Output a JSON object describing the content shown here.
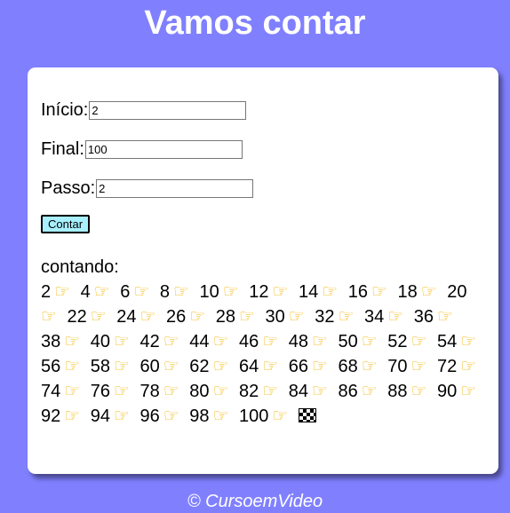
{
  "header": {
    "title": "Vamos contar"
  },
  "form": {
    "inicio_label": "Início:",
    "inicio_value": "2",
    "final_label": "Final:",
    "final_value": "100",
    "passo_label": "Passo:",
    "passo_value": "2",
    "button_label": "Contar"
  },
  "result": {
    "label": "contando:",
    "numbers": [
      "2",
      "4",
      "6",
      "8",
      "10",
      "12",
      "14",
      "16",
      "18",
      "20",
      "22",
      "24",
      "26",
      "28",
      "30",
      "32",
      "34",
      "36",
      "38",
      "40",
      "42",
      "44",
      "46",
      "48",
      "50",
      "52",
      "54",
      "56",
      "58",
      "60",
      "62",
      "64",
      "66",
      "68",
      "70",
      "72",
      "74",
      "76",
      "78",
      "80",
      "82",
      "84",
      "86",
      "88",
      "90",
      "92",
      "94",
      "96",
      "98",
      "100"
    ],
    "separator_icon": "pointing-hand-icon",
    "end_icon": "checkered-flag-icon"
  },
  "footer": {
    "text": "© CursoemVideo"
  },
  "colors": {
    "background": "#8080ff",
    "card": "#ffffff",
    "button": "#a8f0ff",
    "hand": "#f4b400"
  }
}
